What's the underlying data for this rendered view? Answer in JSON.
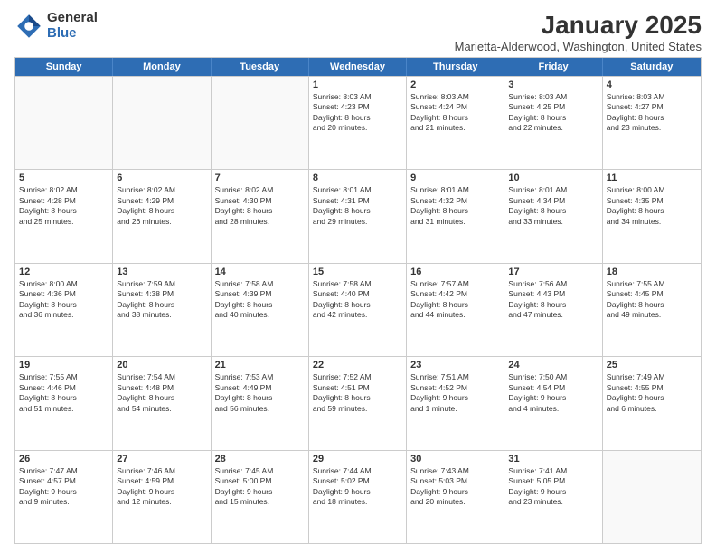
{
  "logo": {
    "general": "General",
    "blue": "Blue"
  },
  "title": {
    "month": "January 2025",
    "location": "Marietta-Alderwood, Washington, United States"
  },
  "weekdays": [
    "Sunday",
    "Monday",
    "Tuesday",
    "Wednesday",
    "Thursday",
    "Friday",
    "Saturday"
  ],
  "weeks": [
    [
      {
        "day": "",
        "info": ""
      },
      {
        "day": "",
        "info": ""
      },
      {
        "day": "",
        "info": ""
      },
      {
        "day": "1",
        "info": "Sunrise: 8:03 AM\nSunset: 4:23 PM\nDaylight: 8 hours\nand 20 minutes."
      },
      {
        "day": "2",
        "info": "Sunrise: 8:03 AM\nSunset: 4:24 PM\nDaylight: 8 hours\nand 21 minutes."
      },
      {
        "day": "3",
        "info": "Sunrise: 8:03 AM\nSunset: 4:25 PM\nDaylight: 8 hours\nand 22 minutes."
      },
      {
        "day": "4",
        "info": "Sunrise: 8:03 AM\nSunset: 4:27 PM\nDaylight: 8 hours\nand 23 minutes."
      }
    ],
    [
      {
        "day": "5",
        "info": "Sunrise: 8:02 AM\nSunset: 4:28 PM\nDaylight: 8 hours\nand 25 minutes."
      },
      {
        "day": "6",
        "info": "Sunrise: 8:02 AM\nSunset: 4:29 PM\nDaylight: 8 hours\nand 26 minutes."
      },
      {
        "day": "7",
        "info": "Sunrise: 8:02 AM\nSunset: 4:30 PM\nDaylight: 8 hours\nand 28 minutes."
      },
      {
        "day": "8",
        "info": "Sunrise: 8:01 AM\nSunset: 4:31 PM\nDaylight: 8 hours\nand 29 minutes."
      },
      {
        "day": "9",
        "info": "Sunrise: 8:01 AM\nSunset: 4:32 PM\nDaylight: 8 hours\nand 31 minutes."
      },
      {
        "day": "10",
        "info": "Sunrise: 8:01 AM\nSunset: 4:34 PM\nDaylight: 8 hours\nand 33 minutes."
      },
      {
        "day": "11",
        "info": "Sunrise: 8:00 AM\nSunset: 4:35 PM\nDaylight: 8 hours\nand 34 minutes."
      }
    ],
    [
      {
        "day": "12",
        "info": "Sunrise: 8:00 AM\nSunset: 4:36 PM\nDaylight: 8 hours\nand 36 minutes."
      },
      {
        "day": "13",
        "info": "Sunrise: 7:59 AM\nSunset: 4:38 PM\nDaylight: 8 hours\nand 38 minutes."
      },
      {
        "day": "14",
        "info": "Sunrise: 7:58 AM\nSunset: 4:39 PM\nDaylight: 8 hours\nand 40 minutes."
      },
      {
        "day": "15",
        "info": "Sunrise: 7:58 AM\nSunset: 4:40 PM\nDaylight: 8 hours\nand 42 minutes."
      },
      {
        "day": "16",
        "info": "Sunrise: 7:57 AM\nSunset: 4:42 PM\nDaylight: 8 hours\nand 44 minutes."
      },
      {
        "day": "17",
        "info": "Sunrise: 7:56 AM\nSunset: 4:43 PM\nDaylight: 8 hours\nand 47 minutes."
      },
      {
        "day": "18",
        "info": "Sunrise: 7:55 AM\nSunset: 4:45 PM\nDaylight: 8 hours\nand 49 minutes."
      }
    ],
    [
      {
        "day": "19",
        "info": "Sunrise: 7:55 AM\nSunset: 4:46 PM\nDaylight: 8 hours\nand 51 minutes."
      },
      {
        "day": "20",
        "info": "Sunrise: 7:54 AM\nSunset: 4:48 PM\nDaylight: 8 hours\nand 54 minutes."
      },
      {
        "day": "21",
        "info": "Sunrise: 7:53 AM\nSunset: 4:49 PM\nDaylight: 8 hours\nand 56 minutes."
      },
      {
        "day": "22",
        "info": "Sunrise: 7:52 AM\nSunset: 4:51 PM\nDaylight: 8 hours\nand 59 minutes."
      },
      {
        "day": "23",
        "info": "Sunrise: 7:51 AM\nSunset: 4:52 PM\nDaylight: 9 hours\nand 1 minute."
      },
      {
        "day": "24",
        "info": "Sunrise: 7:50 AM\nSunset: 4:54 PM\nDaylight: 9 hours\nand 4 minutes."
      },
      {
        "day": "25",
        "info": "Sunrise: 7:49 AM\nSunset: 4:55 PM\nDaylight: 9 hours\nand 6 minutes."
      }
    ],
    [
      {
        "day": "26",
        "info": "Sunrise: 7:47 AM\nSunset: 4:57 PM\nDaylight: 9 hours\nand 9 minutes."
      },
      {
        "day": "27",
        "info": "Sunrise: 7:46 AM\nSunset: 4:59 PM\nDaylight: 9 hours\nand 12 minutes."
      },
      {
        "day": "28",
        "info": "Sunrise: 7:45 AM\nSunset: 5:00 PM\nDaylight: 9 hours\nand 15 minutes."
      },
      {
        "day": "29",
        "info": "Sunrise: 7:44 AM\nSunset: 5:02 PM\nDaylight: 9 hours\nand 18 minutes."
      },
      {
        "day": "30",
        "info": "Sunrise: 7:43 AM\nSunset: 5:03 PM\nDaylight: 9 hours\nand 20 minutes."
      },
      {
        "day": "31",
        "info": "Sunrise: 7:41 AM\nSunset: 5:05 PM\nDaylight: 9 hours\nand 23 minutes."
      },
      {
        "day": "",
        "info": ""
      }
    ]
  ]
}
